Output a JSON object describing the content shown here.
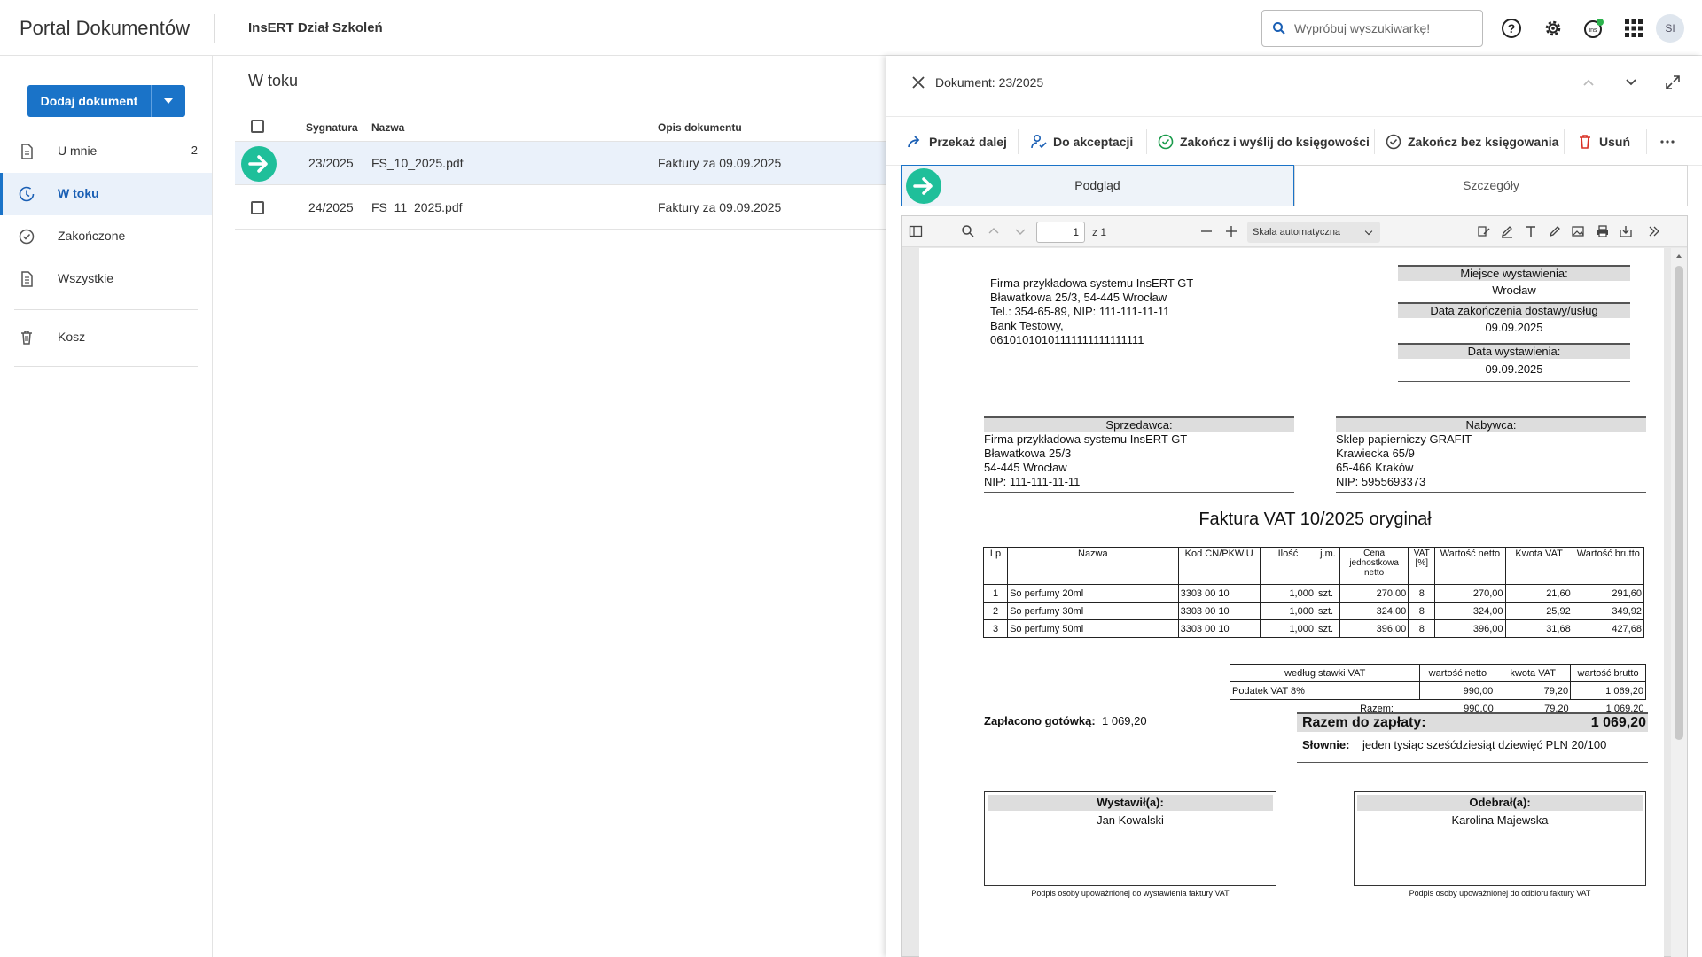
{
  "topbar": {
    "app_title": "Portal Dokumentów",
    "organization": "InsERT Dział Szkoleń",
    "search_placeholder": "Wypróbuj wyszukiwarkę!",
    "avatar_initials": "SI"
  },
  "sidebar": {
    "add_button": "Dodaj dokument",
    "items": [
      {
        "label": "U mnie",
        "count": "2"
      },
      {
        "label": "W toku",
        "count": ""
      },
      {
        "label": "Zakończone",
        "count": ""
      },
      {
        "label": "Wszystkie",
        "count": ""
      },
      {
        "label": "Kosz",
        "count": ""
      }
    ]
  },
  "list": {
    "title": "W toku",
    "columns": {
      "signature": "Sygnatura",
      "name": "Nazwa",
      "description": "Opis dokumentu"
    },
    "rows": [
      {
        "signature": "23/2025",
        "name": "FS_10_2025.pdf",
        "description": "Faktury za 09.09.2025"
      },
      {
        "signature": "24/2025",
        "name": "FS_11_2025.pdf",
        "description": "Faktury za 09.09.2025"
      }
    ]
  },
  "panel": {
    "title": "Dokument: 23/2025",
    "actions": {
      "forward": "Przekaż dalej",
      "to_accept": "Do akceptacji",
      "finish_send": "Zakończ i wyślij do księgowości",
      "finish_no_post": "Zakończ bez księgowania",
      "delete": "Usuń"
    },
    "tabs": {
      "preview": "Podgląd",
      "details": "Szczegóły"
    }
  },
  "viewer": {
    "page_number": "1",
    "page_of": "z 1",
    "scale": "Skala automatyczna"
  },
  "invoice": {
    "seller_header": [
      "Firma przykładowa systemu InsERT GT",
      "Bławatkowa 25/3, 54-445 Wrocław",
      "Tel.: 354-65-89, NIP: 111-111-11-11",
      "Bank Testowy,",
      "06101010101111111111111111"
    ],
    "place_label": "Miejsce wystawienia:",
    "place_value": "Wrocław",
    "delivery_label": "Data zakończenia dostawy/usług",
    "delivery_value": "09.09.2025",
    "issue_label": "Data wystawienia:",
    "issue_value": "09.09.2025",
    "seller_label": "Sprzedawca:",
    "seller_lines": [
      "Firma przykładowa systemu InsERT GT",
      "Bławatkowa 25/3",
      "54-445 Wrocław",
      "NIP: 111-111-11-11"
    ],
    "buyer_label": "Nabywca:",
    "buyer_lines": [
      "Sklep papierniczy GRAFIT",
      "Krawiecka  65/9",
      "65-466 Kraków",
      "NIP: 5955693373"
    ],
    "title": "Faktura VAT  10/2025 oryginał",
    "table_headers": [
      "Lp",
      "Nazwa",
      "Kod CN/PKWiU",
      "Ilość",
      "j.m.",
      "Cena jednostkowa netto",
      "VAT [%]",
      "Wartość netto",
      "Kwota VAT",
      "Wartość brutto"
    ],
    "items": [
      [
        "1",
        "So perfumy 20ml",
        "3303 00 10",
        "1,000",
        "szt.",
        "270,00",
        "8",
        "270,00",
        "21,60",
        "291,60"
      ],
      [
        "2",
        "So perfumy 30ml",
        "3303 00 10",
        "1,000",
        "szt.",
        "324,00",
        "8",
        "324,00",
        "25,92",
        "349,92"
      ],
      [
        "3",
        "So perfumy 50ml",
        "3303 00 10",
        "1,000",
        "szt.",
        "396,00",
        "8",
        "396,00",
        "31,68",
        "427,68"
      ]
    ],
    "vat_headers": [
      "według stawki VAT",
      "wartość netto",
      "kwota VAT",
      "wartość brutto"
    ],
    "vat_row": [
      "Podatek VAT 8%",
      "990,00",
      "79,20",
      "1 069,20"
    ],
    "vat_total": [
      "Razem:",
      "990,00",
      "79,20",
      "1 069,20"
    ],
    "paid_label": "Zapłacono gotówką:",
    "paid_value": "1 069,20",
    "total_label": "Razem do zapłaty:",
    "total_value": "1 069,20",
    "words_label": "Słownie:",
    "words_value": "jeden tysiąc sześćdziesiąt dziewięć  PLN 20/100",
    "issued_by_label": "Wystawił(a):",
    "issued_by": "Jan Kowalski",
    "received_by_label": "Odebrał(a):",
    "received_by": "Karolina Majewska",
    "issued_caption": "Podpis osoby upoważnionej do wystawienia faktury VAT",
    "received_caption": "Podpis osoby upoważnionej do odbioru faktury VAT"
  },
  "colors": {
    "accent": "#1a73c8",
    "selected_row": "#eaf1fa",
    "go_icon": "#1fbf9a",
    "danger": "#d93025",
    "success": "#1a9b4b"
  }
}
